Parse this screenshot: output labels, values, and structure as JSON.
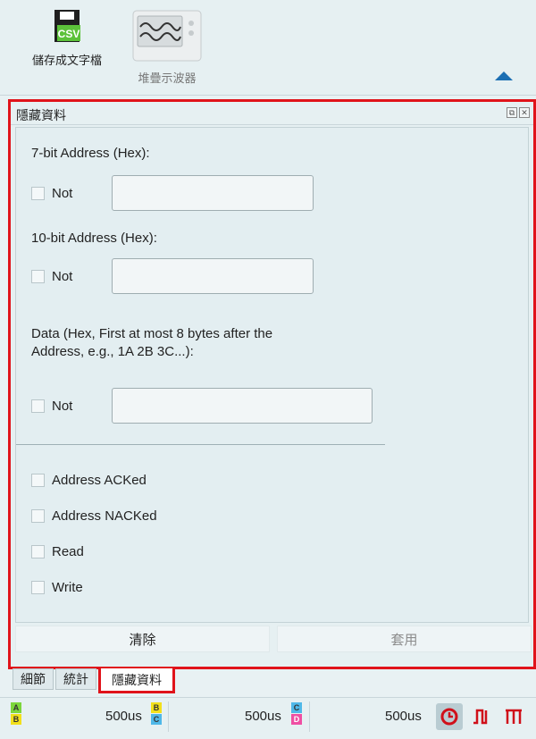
{
  "toolbar": {
    "csv_label": "儲存成文字檔",
    "csv_icon_text": "CSV",
    "scope_label": "堆疊示波器"
  },
  "panel": {
    "title": "隱藏資料",
    "addr7_label": "7-bit Address (Hex):",
    "addr7_not": "Not",
    "addr10_label": "10-bit Address (Hex):",
    "addr10_not": "Not",
    "data_label_line1": "Data (Hex, First at most 8 bytes after the",
    "data_label_line2": "Address, e.g., 1A 2B 3C...):",
    "data_not": "Not",
    "options": [
      "Address ACKed",
      "Address NACKed",
      "Read",
      "Write"
    ],
    "clear_button": "清除",
    "apply_button": "套用"
  },
  "tabs": [
    "細節",
    "統計",
    "隱藏資料"
  ],
  "status": {
    "pair1": [
      "A",
      "B"
    ],
    "time1": "500us",
    "pair2": [
      "B",
      "C"
    ],
    "time2": "500us",
    "pair3": [
      "C",
      "D"
    ],
    "time3": "500us"
  },
  "colors": {
    "highlight": "#e0131a",
    "accent": "#1c6fb3"
  }
}
